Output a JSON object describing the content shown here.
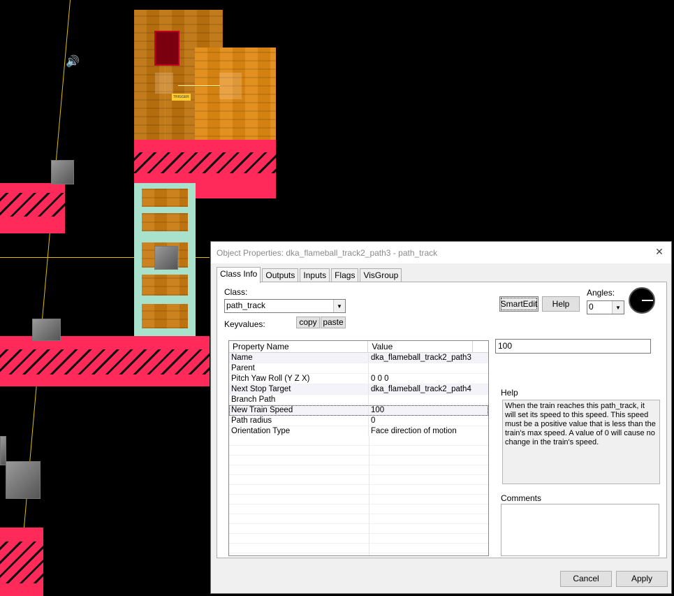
{
  "viewport": {
    "trigger_text": "TRIGGER"
  },
  "dialog": {
    "title": "Object Properties: dka_flameball_track2_path3 - path_track",
    "close_glyph": "✕",
    "tabs": [
      "Class Info",
      "Outputs",
      "Inputs",
      "Flags",
      "VisGroup"
    ],
    "class_label": "Class:",
    "class_value": "path_track",
    "keyvalues_label": "Keyvalues:",
    "copy_label": "copy",
    "paste_label": "paste",
    "smartedit_label": "SmartEdit",
    "help_button_label": "Help",
    "angles_label": "Angles:",
    "angles_value": "0",
    "grid_headers": [
      "Property Name",
      "Value"
    ],
    "rows": [
      {
        "name": "Name",
        "value": "dka_flameball_track2_path3"
      },
      {
        "name": "Parent",
        "value": ""
      },
      {
        "name": "Pitch Yaw Roll (Y Z X)",
        "value": "0 0 0"
      },
      {
        "name": "Next Stop Target",
        "value": "dka_flameball_track2_path4"
      },
      {
        "name": "Branch Path",
        "value": ""
      },
      {
        "name": "New Train Speed",
        "value": "100"
      },
      {
        "name": "Path radius",
        "value": "0"
      },
      {
        "name": "Orientation Type",
        "value": "Face direction of motion"
      }
    ],
    "value_field": "100",
    "help_label": "Help",
    "help_text": "When the train reaches this path_track, it will set its speed to this speed. This speed must be a positive value that is less than the train's max speed. A value of 0 will cause no change in the train's speed.",
    "comments_label": "Comments",
    "cancel_label": "Cancel",
    "apply_label": "Apply"
  }
}
